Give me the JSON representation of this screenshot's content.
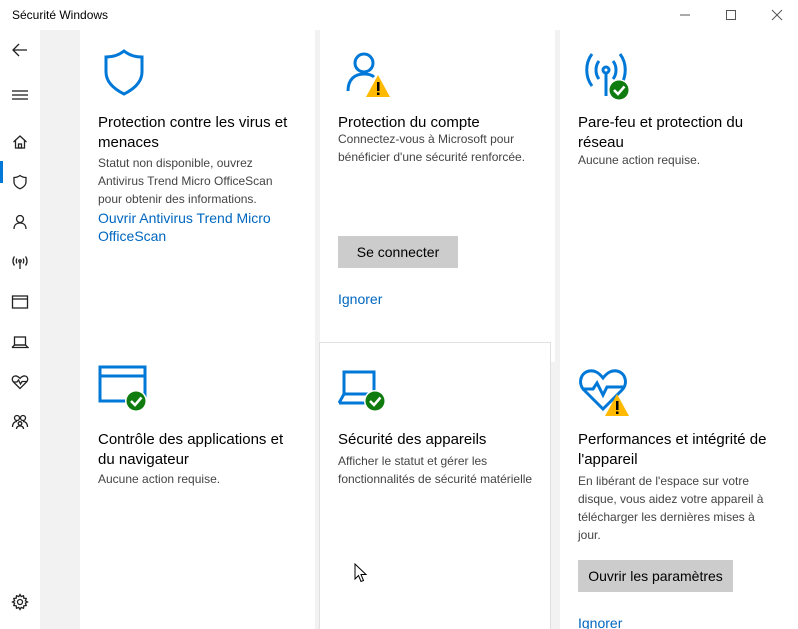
{
  "window": {
    "title": "Sécurité Windows"
  },
  "nav": {
    "items": [
      {
        "name": "back",
        "icon": "back-arrow-icon"
      },
      {
        "name": "menu",
        "icon": "hamburger-icon"
      },
      {
        "name": "home",
        "icon": "home-icon",
        "active": true
      },
      {
        "name": "virus",
        "icon": "shield-icon"
      },
      {
        "name": "account",
        "icon": "person-icon"
      },
      {
        "name": "firewall",
        "icon": "antenna-icon"
      },
      {
        "name": "app-browser",
        "icon": "browser-window-icon"
      },
      {
        "name": "device",
        "icon": "laptop-icon"
      },
      {
        "name": "health",
        "icon": "heart-pulse-icon"
      },
      {
        "name": "family",
        "icon": "family-icon"
      },
      {
        "name": "settings",
        "icon": "gear-icon"
      }
    ]
  },
  "cards": {
    "virus": {
      "title": "Protection contre les virus et menaces",
      "desc": "Statut non disponible, ouvrez Antivirus Trend Micro OfficeScan pour obtenir des informations.",
      "link": "Ouvrir Antivirus Trend Micro OfficeScan",
      "status": "unknown"
    },
    "account": {
      "title": "Protection du compte",
      "desc": "Connectez-vous à Microsoft pour bénéficier d'une sécurité renforcée.",
      "button": "Se connecter",
      "link": "Ignorer",
      "status": "warning"
    },
    "firewall": {
      "title": "Pare-feu et protection du réseau",
      "desc": "Aucune action requise.",
      "status": "ok"
    },
    "appbrowser": {
      "title": "Contrôle des applications et du navigateur",
      "desc": "Aucune action requise.",
      "status": "ok"
    },
    "device": {
      "title": "Sécurité des appareils",
      "desc": "Afficher le statut et gérer les fonctionnalités de sécurité matérielle",
      "status": "ok"
    },
    "health": {
      "title": "Performances et intégrité de l'appareil",
      "desc": "En libérant de l'espace sur votre disque, vous aidez votre appareil à télécharger les dernières mises à jour.",
      "button": "Ouvrir les paramètres",
      "link": "Ignorer",
      "status": "warning"
    }
  },
  "colors": {
    "accent": "#0078d7",
    "link": "#0067c0",
    "ok": "#107c10",
    "warning": "#ffb900",
    "button": "#cccccc"
  }
}
